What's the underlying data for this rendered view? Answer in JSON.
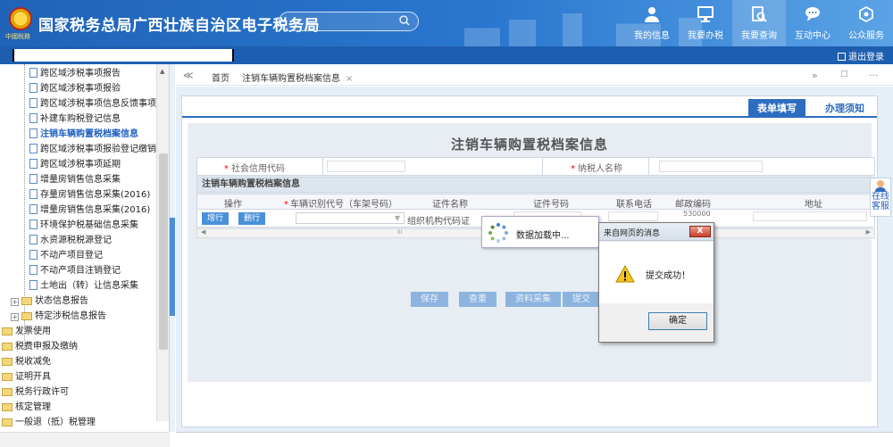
{
  "header": {
    "emblem_text": "中國稅務",
    "title": "国家税务总局广西壮族自治区电子税务局",
    "search": {
      "placeholder": ""
    },
    "nav": [
      {
        "label": "我的信息",
        "icon": "user-icon"
      },
      {
        "label": "我要办税",
        "icon": "monitor-icon"
      },
      {
        "label": "我要查询",
        "icon": "query-icon"
      },
      {
        "label": "互动中心",
        "icon": "chat-icon"
      },
      {
        "label": "公众服务",
        "icon": "service-icon"
      }
    ]
  },
  "subbar": {
    "logout": "退出登录"
  },
  "sidebar": {
    "items": [
      {
        "label": "跨区域涉税事项报告",
        "type": "file"
      },
      {
        "label": "跨区域涉税事项报验",
        "type": "file"
      },
      {
        "label": "跨区域涉税事项信息反馈事项",
        "type": "file"
      },
      {
        "label": "补建车购税登记信息",
        "type": "file"
      },
      {
        "label": "注销车辆购置税档案信息",
        "type": "file",
        "active": true
      },
      {
        "label": "跨区域涉税事项报验登记缴销",
        "type": "file"
      },
      {
        "label": "跨区域涉税事项延期",
        "type": "file"
      },
      {
        "label": "增量房销售信息采集",
        "type": "file"
      },
      {
        "label": "存量房销售信息采集(2016)",
        "type": "file"
      },
      {
        "label": "增量房销售信息采集(2016)",
        "type": "file"
      },
      {
        "label": "环境保护税基础信息采集",
        "type": "file"
      },
      {
        "label": "水资源税税源登记",
        "type": "file"
      },
      {
        "label": "不动产项目登记",
        "type": "file"
      },
      {
        "label": "不动产项目注销登记",
        "type": "file"
      },
      {
        "label": "土地出（转）让信息采集",
        "type": "file"
      },
      {
        "label": "状态信息报告",
        "type": "folder-exp"
      },
      {
        "label": "特定涉税信息报告",
        "type": "folder-exp"
      },
      {
        "label": "发票使用",
        "type": "folder"
      },
      {
        "label": "税费申报及缴纳",
        "type": "folder"
      },
      {
        "label": "税收减免",
        "type": "folder"
      },
      {
        "label": "证明开具",
        "type": "folder"
      },
      {
        "label": "税务行政许可",
        "type": "folder"
      },
      {
        "label": "核定管理",
        "type": "folder"
      },
      {
        "label": "一般退（抵）税管理",
        "type": "folder"
      }
    ]
  },
  "tabs": {
    "prev": "≪",
    "home": "首页",
    "current": "注销车辆购置税档案信息",
    "close": "×",
    "next": "»",
    "minimize": "□",
    "more": "···"
  },
  "panel": {
    "tabs": [
      "表单填写",
      "办理须知"
    ],
    "title": "注销车辆购置税档案信息",
    "credit_code_label": "社会信用代码",
    "taxpayer_name_label": "纳税人名称",
    "section_header": "注销车辆购置税档案信息",
    "columns": [
      "操作",
      "车辆识别代号（车架号码）",
      "证件名称",
      "证件号码",
      "联系电话",
      "邮政编码",
      "地址"
    ],
    "row": {
      "add": "增行",
      "delete": "删行",
      "vin_select": "",
      "doc_name": "组织机构代码证",
      "postal_code": "530000"
    },
    "scroll_mark": "III",
    "actions": [
      "保存",
      "查重",
      "资料采集",
      "提交"
    ]
  },
  "loading": {
    "text": "数据加载中..."
  },
  "dialog": {
    "title": "来自网页的消息",
    "close": "X",
    "message": "提交成功！",
    "ok": "确定"
  },
  "side_service": {
    "line1": "在线",
    "line2": "客服"
  }
}
